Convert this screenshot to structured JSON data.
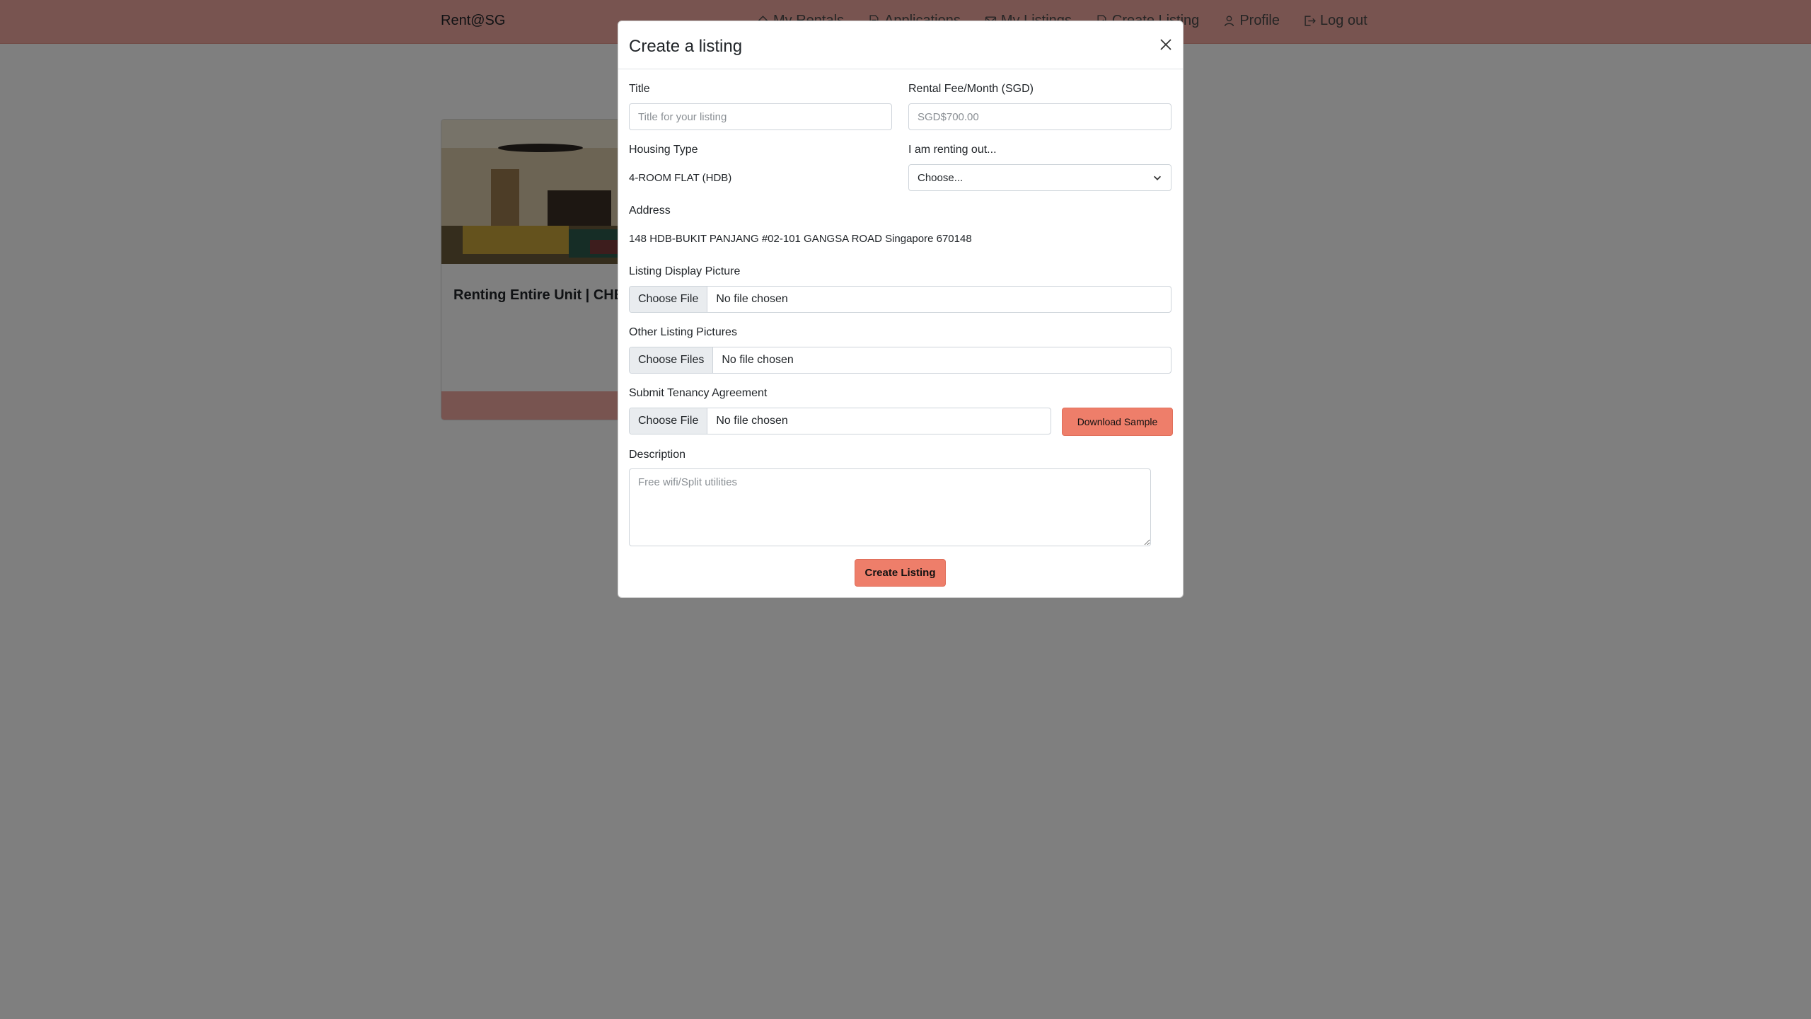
{
  "navbar": {
    "brand": "Rent@SG",
    "links": [
      {
        "label": "My Rentals",
        "icon": "house-icon"
      },
      {
        "label": "Applications",
        "icon": "document-icon"
      },
      {
        "label": "My Listings",
        "icon": "envelope-icon"
      },
      {
        "label": "Create Listing",
        "icon": "document-edit-icon"
      },
      {
        "label": "Profile",
        "icon": "person-icon"
      },
      {
        "label": "Log out",
        "icon": "logout-icon"
      }
    ]
  },
  "card": {
    "title": "Renting Entire Unit | CHEAPEST | NEGOTIABLE"
  },
  "modal": {
    "title": "Create a listing",
    "fields": {
      "title": {
        "label": "Title",
        "placeholder": "Title for your listing",
        "value": ""
      },
      "rental_fee": {
        "label": "Rental Fee/Month (SGD)",
        "placeholder": "SGD$700.00",
        "value": ""
      },
      "housing_type": {
        "label": "Housing Type",
        "value": "4-ROOM FLAT (HDB)"
      },
      "renting_out": {
        "label": "I am renting out...",
        "value": "Choose..."
      },
      "address": {
        "label": "Address",
        "value": "148 HDB-BUKIT PANJANG #02-101 GANGSA ROAD Singapore 670148"
      },
      "display_picture": {
        "label": "Listing Display Picture",
        "button": "Choose File",
        "file": "No file chosen"
      },
      "other_pictures": {
        "label": "Other Listing Pictures",
        "button": "Choose Files",
        "file": "No file chosen"
      },
      "tenancy_agreement": {
        "label": "Submit Tenancy Agreement",
        "button": "Choose File",
        "file": "No file chosen",
        "download_label": "Download Sample"
      },
      "description": {
        "label": "Description",
        "placeholder": "Free wifi/Split utilities",
        "value": ""
      }
    },
    "submit_label": "Create Listing"
  },
  "colors": {
    "navbar_bg": "#f1a9a0",
    "accent_button": "#ee7e6a",
    "backdrop": "rgba(0,0,0,0.5)"
  }
}
